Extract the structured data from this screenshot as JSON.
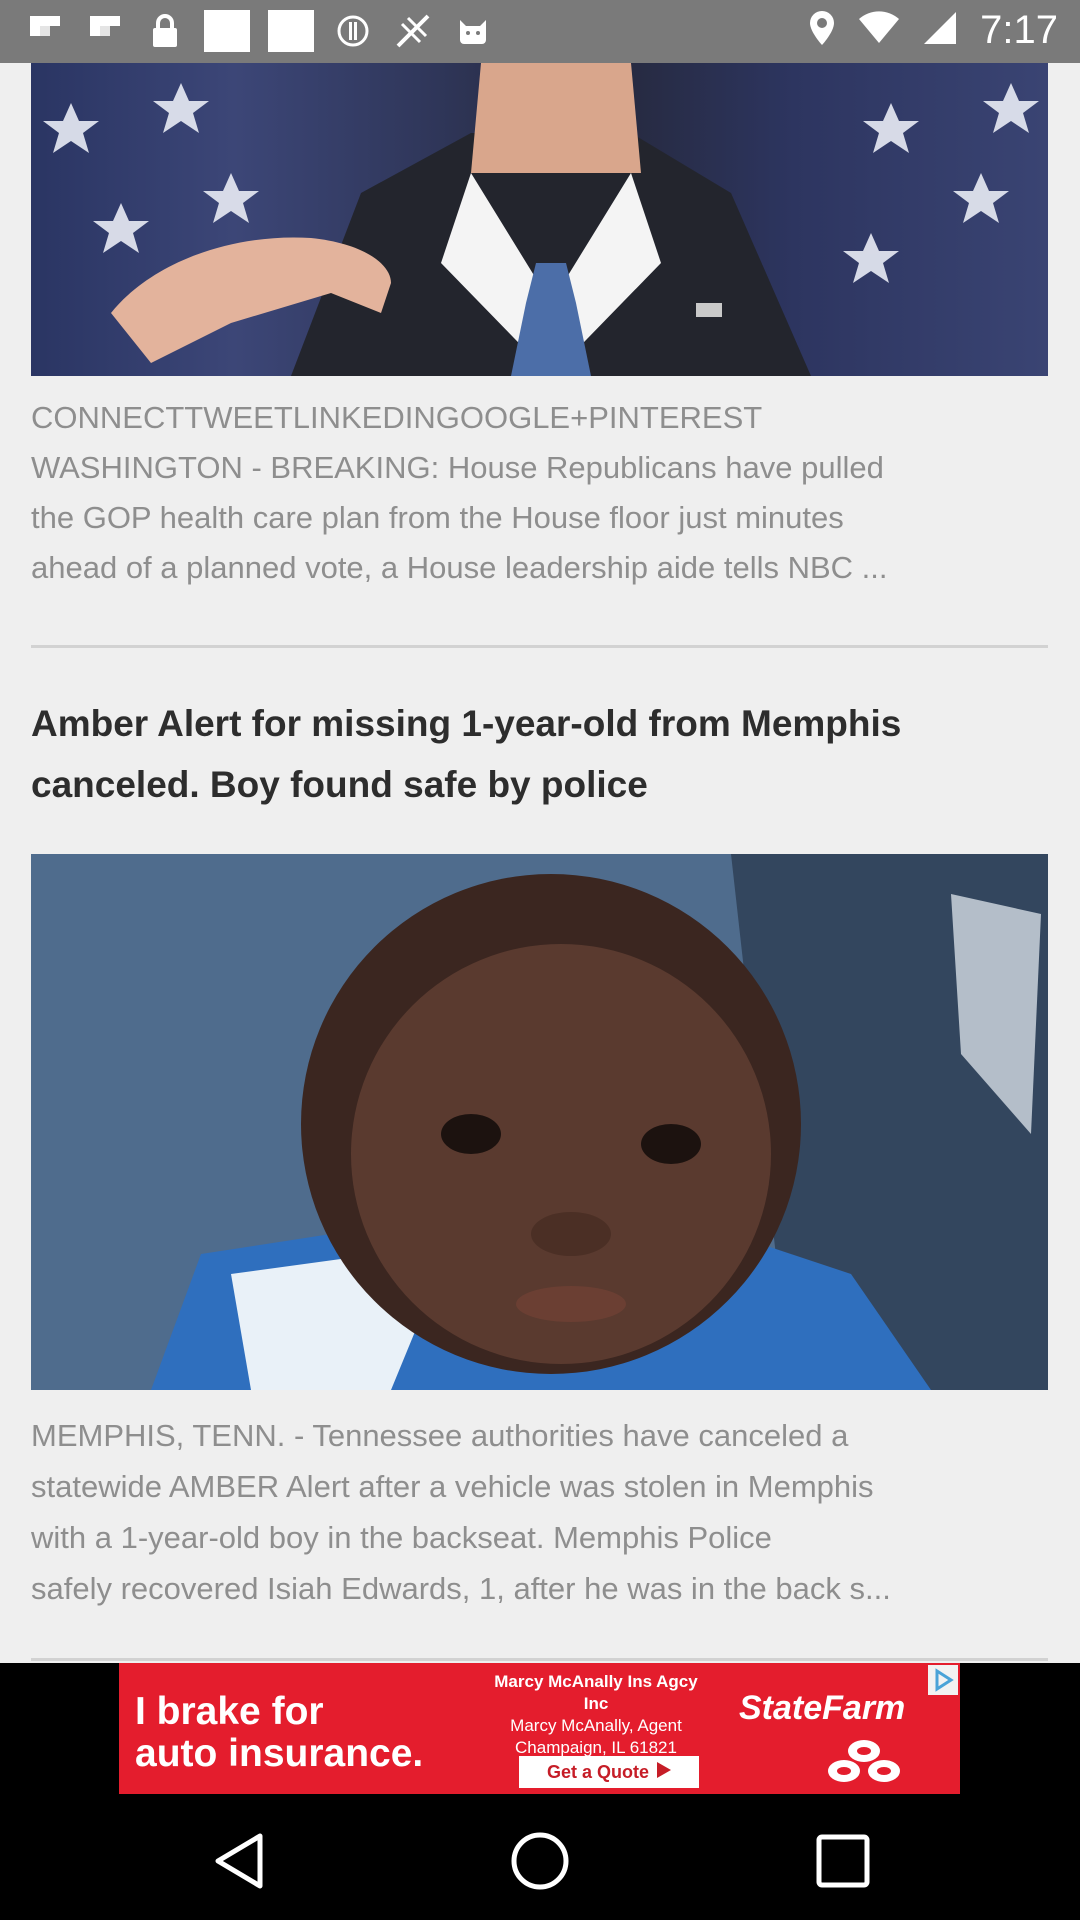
{
  "status_bar": {
    "time": "7:17",
    "left_icons": [
      "flipboard-icon",
      "flipboard-icon",
      "lock-icon",
      "blank-notification-icon",
      "blank-notification-icon",
      "alert-icon",
      "no-signal-icon",
      "cat-icon"
    ],
    "right_icons": [
      "location-icon",
      "wifi-icon",
      "signal-icon"
    ]
  },
  "article1": {
    "share_line": "CONNECTTWEETLINKEDINGOOGLE+PINTEREST",
    "body_lines": [
      "WASHINGTON - BREAKING: House Republicans have pulled",
      "the GOP health care plan from the House floor just minutes",
      "ahead of a planned vote, a House leadership aide tells NBC ..."
    ]
  },
  "article2": {
    "title": "Amber Alert for missing 1-year-old from Memphis canceled. Boy found safe by police",
    "body_lines": [
      "MEMPHIS, TENN. - Tennessee authorities have canceled a",
      "statewide AMBER Alert after a vehicle was stolen in Memphis",
      "with a 1-year-old boy in the backseat.        Memphis Police",
      "safely recovered Isiah Edwards, 1, after he was in the back s..."
    ]
  },
  "ad": {
    "headline_line1": "I brake for",
    "headline_line2": "auto insurance.",
    "agent_name": "Marcy McAnally Ins Agcy Inc",
    "agent_line2": "Marcy McAnally, Agent",
    "agent_line3": "Champaign, IL 61821",
    "cta": "Get a Quote",
    "brand": "StateFarm",
    "colors": {
      "background": "#e41d2d",
      "text": "#ffffff"
    }
  },
  "nav_bar": {
    "icons": [
      "back-icon",
      "home-icon",
      "recents-icon"
    ]
  }
}
